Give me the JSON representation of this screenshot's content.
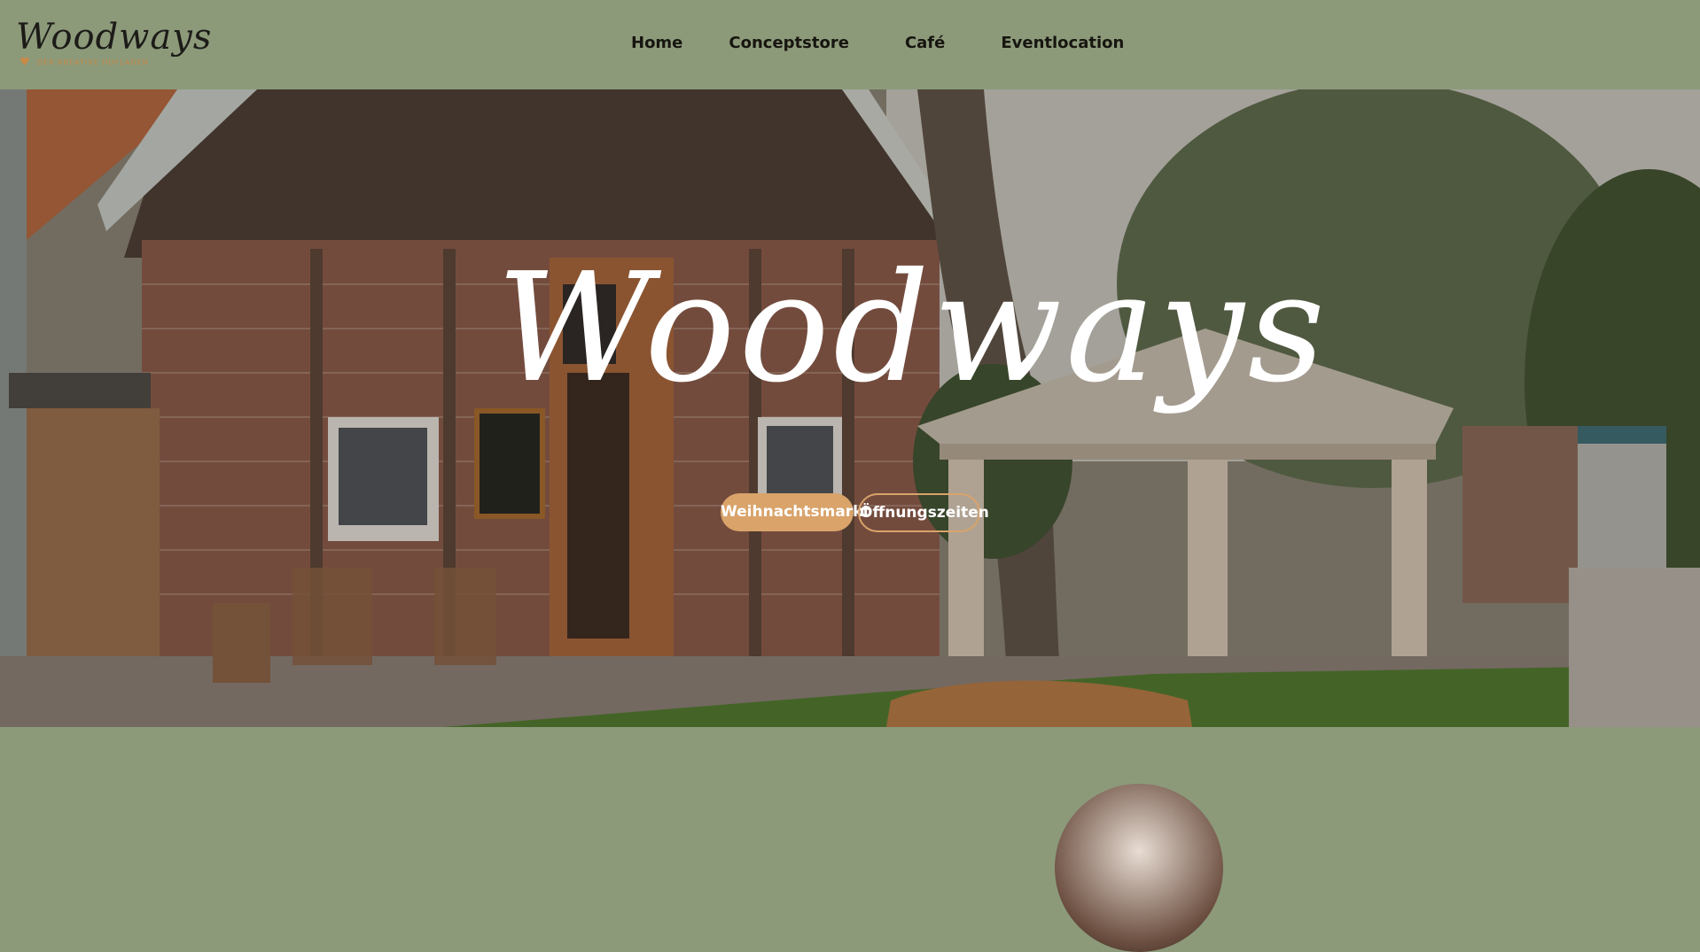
{
  "logo": {
    "wordmark": "Woodways",
    "tagline": "DER KREATIVE HOFLADEN"
  },
  "nav": {
    "items": [
      {
        "label": "Home",
        "active": true
      },
      {
        "label": "Conceptstore",
        "active": false
      },
      {
        "label": "Café",
        "active": false
      },
      {
        "label": "Eventlocation",
        "active": false
      }
    ]
  },
  "hero": {
    "title": "Woodways",
    "sign_text": "Woodways",
    "buttons": {
      "primary": "Weihnachtsmarkt",
      "secondary": "Öffnungszeiten"
    }
  },
  "colors": {
    "background": "#8c9a7a",
    "accent": "#d9a36a",
    "text_dark": "#17150f",
    "text_light": "#ffffff"
  }
}
